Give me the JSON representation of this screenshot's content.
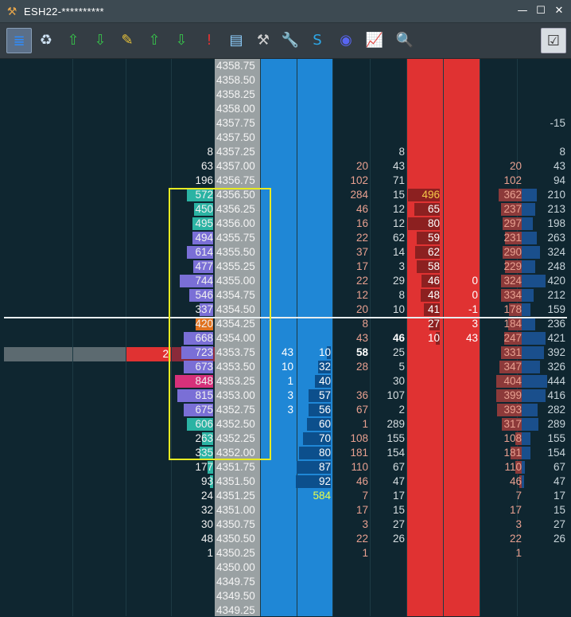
{
  "window": {
    "title": "ESH22-**********",
    "minimize": "—",
    "maximize": "☐",
    "close": "✕"
  },
  "toolbar": {
    "buttons": [
      {
        "name": "depth-icon",
        "glyph": "≣",
        "color": "#2d8cff"
      },
      {
        "name": "recycle-bin-icon",
        "glyph": "♻",
        "color": "#cfe3f5"
      },
      {
        "name": "upload-green-icon",
        "glyph": "⇧",
        "color": "#37c24a"
      },
      {
        "name": "download-green-icon",
        "glyph": "⇩",
        "color": "#37c24a"
      },
      {
        "name": "pencil-icon",
        "glyph": "✎",
        "color": "#e8c23a"
      },
      {
        "name": "upload-green-2-icon",
        "glyph": "⇧",
        "color": "#37c24a"
      },
      {
        "name": "download-green-2-icon",
        "glyph": "⇩",
        "color": "#37c24a"
      },
      {
        "name": "alert-icon",
        "glyph": "!",
        "color": "#e03232"
      },
      {
        "name": "report-icon",
        "glyph": "▤",
        "color": "#8fd0ff"
      },
      {
        "name": "tools-icon",
        "glyph": "⚒",
        "color": "#cfcfcf"
      },
      {
        "name": "wrench-icon",
        "glyph": "🔧",
        "color": "#4aa8ff"
      },
      {
        "name": "s-brand-icon",
        "glyph": "S",
        "color": "#2da8e8"
      },
      {
        "name": "discord-icon",
        "glyph": "◉",
        "color": "#5865f2"
      },
      {
        "name": "chart-icon",
        "glyph": "📈",
        "color": "#d83030"
      },
      {
        "name": "magnifier-icon",
        "glyph": "🔍",
        "color": "#9fd0ff"
      }
    ],
    "settings": {
      "name": "checklist-icon",
      "glyph": "☑"
    }
  },
  "ladder": {
    "current_price_bar": {
      "value": "2"
    },
    "rows": [
      {
        "p": "4358.75"
      },
      {
        "p": "4358.50"
      },
      {
        "p": "4358.25"
      },
      {
        "p": "4358.00"
      },
      {
        "p": "4357.75",
        "r2": "-15"
      },
      {
        "p": "4357.50"
      },
      {
        "p": "4357.25",
        "vol": "8",
        "bs": "8",
        "r2": "8"
      },
      {
        "p": "4357.00",
        "vol": "63",
        "ss": "20",
        "bs": "43",
        "r1": "20",
        "r2": "43"
      },
      {
        "p": "4356.75",
        "vol": "196",
        "ss": "102",
        "bs": "71",
        "r1": "102",
        "r2": "94"
      },
      {
        "p": "4356.50",
        "vol": "572",
        "ss": "284",
        "bs": "15",
        "ask": "496",
        "r1": "362",
        "r2": "210",
        "vb": 0.62,
        "vc": "#2bb3a3",
        "r1b": 0.55,
        "r2b": 0.35
      },
      {
        "p": "4356.25",
        "vol": "450",
        "ss": "46",
        "bs": "12",
        "ask": "65",
        "r1": "237",
        "r2": "213",
        "vb": 0.45,
        "vc": "#2bb3a3",
        "r1b": 0.5,
        "r2b": 0.3
      },
      {
        "p": "4356.00",
        "vol": "495",
        "ss": "16",
        "bs": "12",
        "ask": "80",
        "r1": "297",
        "r2": "198",
        "vb": 0.5,
        "vc": "#2bb3a3",
        "r1b": 0.45,
        "r2b": 0.25
      },
      {
        "p": "4355.75",
        "vol": "494",
        "ss": "22",
        "bs": "62",
        "ask": "59",
        "r1": "231",
        "r2": "263",
        "vb": 0.5,
        "vc": "#7a6fd6",
        "r1b": 0.4,
        "r2b": 0.35
      },
      {
        "p": "4355.50",
        "vol": "614",
        "ss": "37",
        "bs": "14",
        "ask": "62",
        "r1": "290",
        "r2": "324",
        "vb": 0.62,
        "vc": "#7a6fd6",
        "r1b": 0.45,
        "r2b": 0.42
      },
      {
        "p": "4355.25",
        "vol": "477",
        "ss": "17",
        "bs": "3",
        "ask": "58",
        "r1": "229",
        "r2": "248",
        "vb": 0.48,
        "vc": "#7a6fd6",
        "r1b": 0.4,
        "r2b": 0.3
      },
      {
        "p": "4355.00",
        "vol": "744",
        "ss": "22",
        "bs": "29",
        "ask": "46",
        "ask2": "0",
        "r1": "324",
        "r2": "420",
        "vb": 0.8,
        "vc": "#7a6fd6",
        "r1b": 0.5,
        "r2b": 0.55
      },
      {
        "p": "4354.75",
        "vol": "546",
        "ss": "12",
        "bs": "8",
        "ask": "48",
        "ask2": "0",
        "r1": "334",
        "r2": "212",
        "vb": 0.56,
        "vc": "#7a6fd6",
        "r1b": 0.5,
        "r2b": 0.28
      },
      {
        "p": "4354.50",
        "vol": "337",
        "ss": "20",
        "bs": "10",
        "ask": "41",
        "ask2": "-1",
        "r1": "178",
        "r2": "159",
        "vb": 0.33,
        "vc": "#7a6fd6",
        "r1b": 0.3,
        "r2b": 0.2
      },
      {
        "p": "4354.25",
        "vol": "420",
        "ss": "8",
        "ask": "27",
        "ask2": "3",
        "r1": "184",
        "r2": "236",
        "vb": 0.42,
        "vc": "#e0721f",
        "r1b": 0.32,
        "r2b": 0.3
      },
      {
        "p": "4354.00",
        "vol": "668",
        "ss": "43",
        "bs": "46",
        "ask": "10",
        "ask2": "43",
        "r1": "247",
        "r2": "421",
        "vb": 0.7,
        "vc": "#7a6fd6",
        "r1b": 0.42,
        "r2b": 0.55
      },
      {
        "p": "4353.75",
        "vol": "723",
        "bid": "43",
        "bid2": "10",
        "ss": "58",
        "bs": "25",
        "r1": "331",
        "r2": "392",
        "vb": 0.75,
        "vc": "#7a6fd6",
        "r1b": 0.5,
        "r2b": 0.5
      },
      {
        "p": "4353.50",
        "vol": "673",
        "bid": "10",
        "bid2": "32",
        "ss": "28",
        "bs": "5",
        "r1": "347",
        "r2": "326",
        "vb": 0.7,
        "vc": "#7a6fd6",
        "r1b": 0.52,
        "r2b": 0.42
      },
      {
        "p": "4353.25",
        "vol": "848",
        "bid": "1",
        "bid2": "40",
        "bs": "30",
        "r1": "404",
        "r2": "444",
        "vb": 0.9,
        "vc": "#d6317a",
        "r1b": 0.6,
        "r2b": 0.58
      },
      {
        "p": "4353.00",
        "vol": "815",
        "bid": "3",
        "bid2": "57",
        "ss": "36",
        "bs": "107",
        "r1": "399",
        "r2": "416",
        "vb": 0.85,
        "vc": "#7a6fd6",
        "r1b": 0.6,
        "r2b": 0.55
      },
      {
        "p": "4352.75",
        "vol": "675",
        "bid": "3",
        "bid2": "56",
        "ss": "67",
        "bs": "2",
        "r1": "393",
        "r2": "282",
        "vb": 0.7,
        "vc": "#7a6fd6",
        "r1b": 0.58,
        "r2b": 0.36
      },
      {
        "p": "4352.50",
        "vol": "606",
        "bid2": "60",
        "ss": "1",
        "bs": "289",
        "r1": "317",
        "r2": "289",
        "vb": 0.62,
        "vc": "#2bb3a3",
        "r1b": 0.48,
        "r2b": 0.38
      },
      {
        "p": "4352.25",
        "vol": "263",
        "bid2": "70",
        "ss": "108",
        "bs": "155",
        "r1": "108",
        "r2": "155",
        "vb": 0.26,
        "vc": "#2bb3a3",
        "r1b": 0.16,
        "r2b": 0.2
      },
      {
        "p": "4352.00",
        "vol": "335",
        "bid2": "80",
        "ss": "181",
        "bs": "154",
        "r1": "181",
        "r2": "154",
        "vb": 0.33,
        "vc": "#2bb3a3",
        "r1b": 0.27,
        "r2b": 0.2
      },
      {
        "p": "4351.75",
        "vol": "177",
        "bid2": "87",
        "ss": "110",
        "bs": "67",
        "r1": "110",
        "r2": "67",
        "vb": 0.14,
        "vc": "#2bb3a3",
        "r1b": 0.16,
        "r2b": 0.08
      },
      {
        "p": "4351.50",
        "vol": "93",
        "bid2": "92",
        "ss": "46",
        "bs": "47",
        "r1": "46",
        "r2": "47",
        "vb": 0.08,
        "vc": "#2bb3a3",
        "r1b": 0.06,
        "r2b": 0.05
      },
      {
        "p": "4351.25",
        "vol": "24",
        "bid2": "584",
        "ss": "7",
        "bs": "17",
        "r1": "7",
        "r2": "17"
      },
      {
        "p": "4351.00",
        "vol": "32",
        "ss": "17",
        "bs": "15",
        "r1": "17",
        "r2": "15"
      },
      {
        "p": "4350.75",
        "vol": "30",
        "ss": "3",
        "bs": "27",
        "r1": "3",
        "r2": "27"
      },
      {
        "p": "4350.50",
        "vol": "48",
        "ss": "22",
        "bs": "26",
        "r1": "22",
        "r2": "26"
      },
      {
        "p": "4350.25",
        "vol": "1",
        "ss": "1",
        "r1": "1"
      },
      {
        "p": "4350.00"
      },
      {
        "p": "4349.75"
      },
      {
        "p": "4349.50"
      },
      {
        "p": "4349.25"
      }
    ]
  },
  "colors": {
    "bid": "#1f87d6",
    "ask": "#e03232",
    "price": "#9aa1a3",
    "highlight_box": "#e6ea22",
    "ask_highlight": "#f7c948",
    "bid_highlight": "#e9ff4a"
  }
}
